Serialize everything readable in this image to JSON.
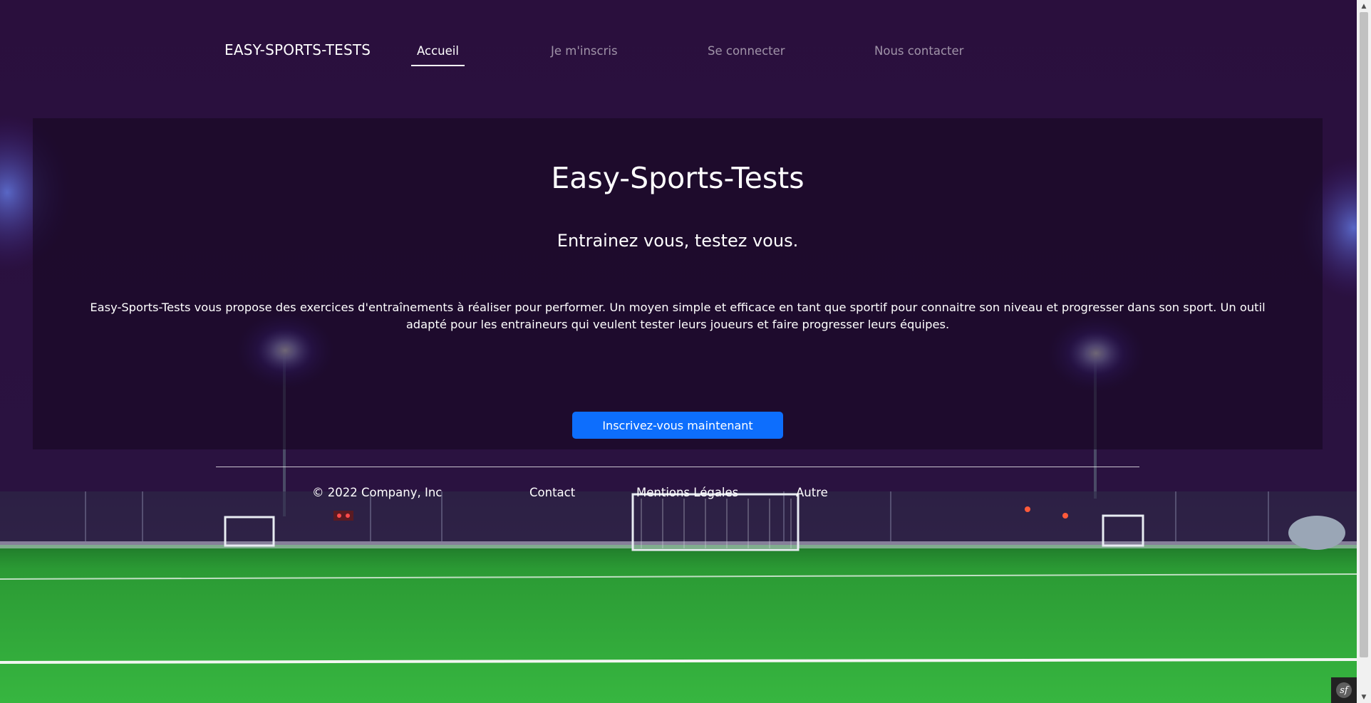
{
  "navbar": {
    "brand": "EASY-SPORTS-TESTS",
    "links": [
      {
        "label": "Accueil",
        "active": true
      },
      {
        "label": "Je m'inscris",
        "active": false
      },
      {
        "label": "Se connecter",
        "active": false
      },
      {
        "label": "Nous contacter",
        "active": false
      }
    ]
  },
  "hero": {
    "title": "Easy-Sports-Tests",
    "subtitle": "Entrainez vous, testez vous.",
    "description": "Easy-Sports-Tests vous propose des exercices d'entraînements à réaliser pour performer. Un moyen simple et efficace en tant que sportif pour connaitre son niveau et progresser dans son sport. Un outil adapté pour les entraineurs qui veulent tester leurs joueurs et faire progresser leurs équipes.",
    "cta_label": "Inscrivez-vous maintenant"
  },
  "footer": {
    "copyright": "© 2022 Company, Inc",
    "links": [
      "Contact",
      "Mentions Légales",
      "Autre"
    ]
  },
  "background": {
    "description_icon": "stadium-night-background"
  },
  "colors": {
    "accent": "#0d6efd",
    "header_bg": "#29103c",
    "grass": "#2fae3c"
  },
  "debug_toolbar": {
    "icon": "symfony-icon",
    "glyph": "sf"
  }
}
